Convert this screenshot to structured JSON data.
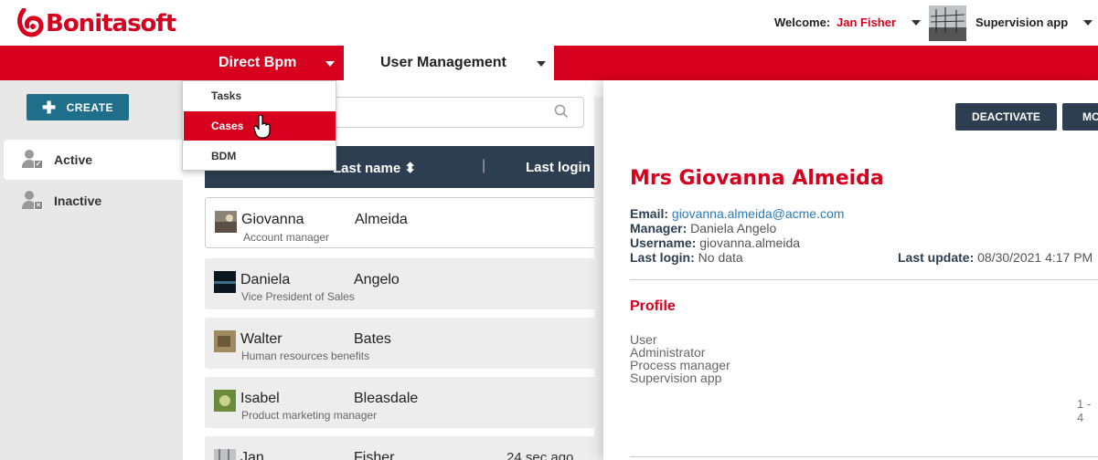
{
  "header": {
    "logo_text": "Bonitasoft",
    "welcome_label": "Welcome:",
    "user_name": "Jan Fisher",
    "app_name": "Supervision app"
  },
  "nav": {
    "tabs": [
      {
        "label": "Direct Bpm"
      },
      {
        "label": "User Management"
      }
    ],
    "dropdown": [
      {
        "label": "Tasks"
      },
      {
        "label": "Cases"
      },
      {
        "label": "BDM"
      }
    ]
  },
  "sidebar": {
    "create_label": "CREATE",
    "items": [
      {
        "label": "Active"
      },
      {
        "label": "Inactive"
      }
    ]
  },
  "list": {
    "search_placeholder": "",
    "columns": {
      "last_name": "Last name",
      "last_login": "Last login"
    },
    "rows": [
      {
        "first": "Giovanna",
        "last": "Almeida",
        "job": "Account manager",
        "ago": ""
      },
      {
        "first": "Daniela",
        "last": "Angelo",
        "job": "Vice President of Sales",
        "ago": ""
      },
      {
        "first": "Walter",
        "last": "Bates",
        "job": "Human resources benefits",
        "ago": ""
      },
      {
        "first": "Isabel",
        "last": "Bleasdale",
        "job": "Product marketing manager",
        "ago": ""
      },
      {
        "first": "Jan",
        "last": "Fisher",
        "job": "",
        "ago": "24 sec ago"
      }
    ]
  },
  "detail": {
    "buttons": {
      "deactivate": "DEACTIVATE",
      "more": "MO"
    },
    "title": "Mrs Giovanna Almeida",
    "email_label": "Email:",
    "email": "giovanna.almeida@acme.com",
    "manager_label": "Manager:",
    "manager": "Daniela Angelo",
    "username_label": "Username:",
    "username": "giovanna.almeida",
    "last_login_label": "Last login:",
    "last_login": "No data",
    "last_update_label": "Last update:",
    "last_update": "08/30/2021 4:17 PM",
    "profile_title": "Profile",
    "profiles": [
      "User",
      "Administrator",
      "Process manager",
      "Supervision app"
    ],
    "pager": "1 - 4"
  },
  "colors": {
    "brand_red": "#d7001e",
    "navy": "#2c3e50",
    "create_blue": "#1f6f8b",
    "link_blue": "#2a7bb8"
  }
}
